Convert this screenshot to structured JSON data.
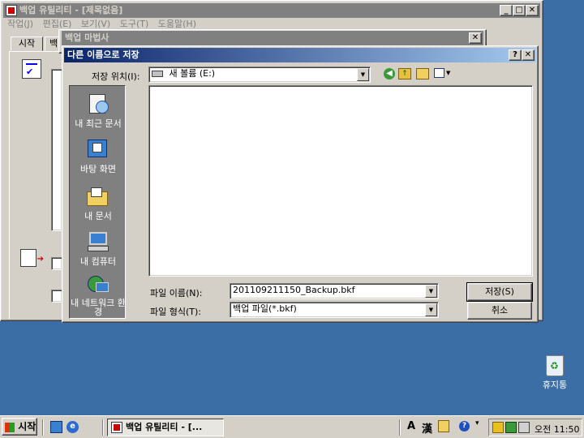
{
  "backup_window": {
    "title": "백업 유틸리티 - [제목없음]",
    "menus": [
      "작업(J)",
      "편집(E)",
      "보기(V)",
      "도구(T)",
      "도움말(H)"
    ],
    "tabs": [
      "시작",
      "백"
    ]
  },
  "wizard_window": {
    "title": "백업 마법사"
  },
  "save_dialog": {
    "title": "다른 이름으로 저장",
    "save_in_label": "저장 위치(I):",
    "save_in_value": "새 볼륨 (E:)",
    "places": [
      "내 최근 문서",
      "바탕 화면",
      "내 문서",
      "내 컴퓨터",
      "내 네트워크 환경"
    ],
    "filename_label": "파일 이름(N):",
    "filename_value": "201109211150_Backup.bkf",
    "filetype_label": "파일 형식(T):",
    "filetype_value": "백업 파일(*.bkf)",
    "save_button": "저장(S)",
    "cancel_button": "취소"
  },
  "desktop": {
    "recycle_bin_label": "휴지통"
  },
  "taskbar": {
    "start_label": "시작",
    "task_label": "백업 유틸리티 - [...",
    "lang_a": "A",
    "lang_han": "漢",
    "clock": "오전 11:50"
  },
  "colors": {
    "desktop": "#3a6ea5",
    "title_active": "#0a246a",
    "title_inactive": "#808080",
    "face": "#d4d0c8",
    "places_bar": "#808080"
  }
}
